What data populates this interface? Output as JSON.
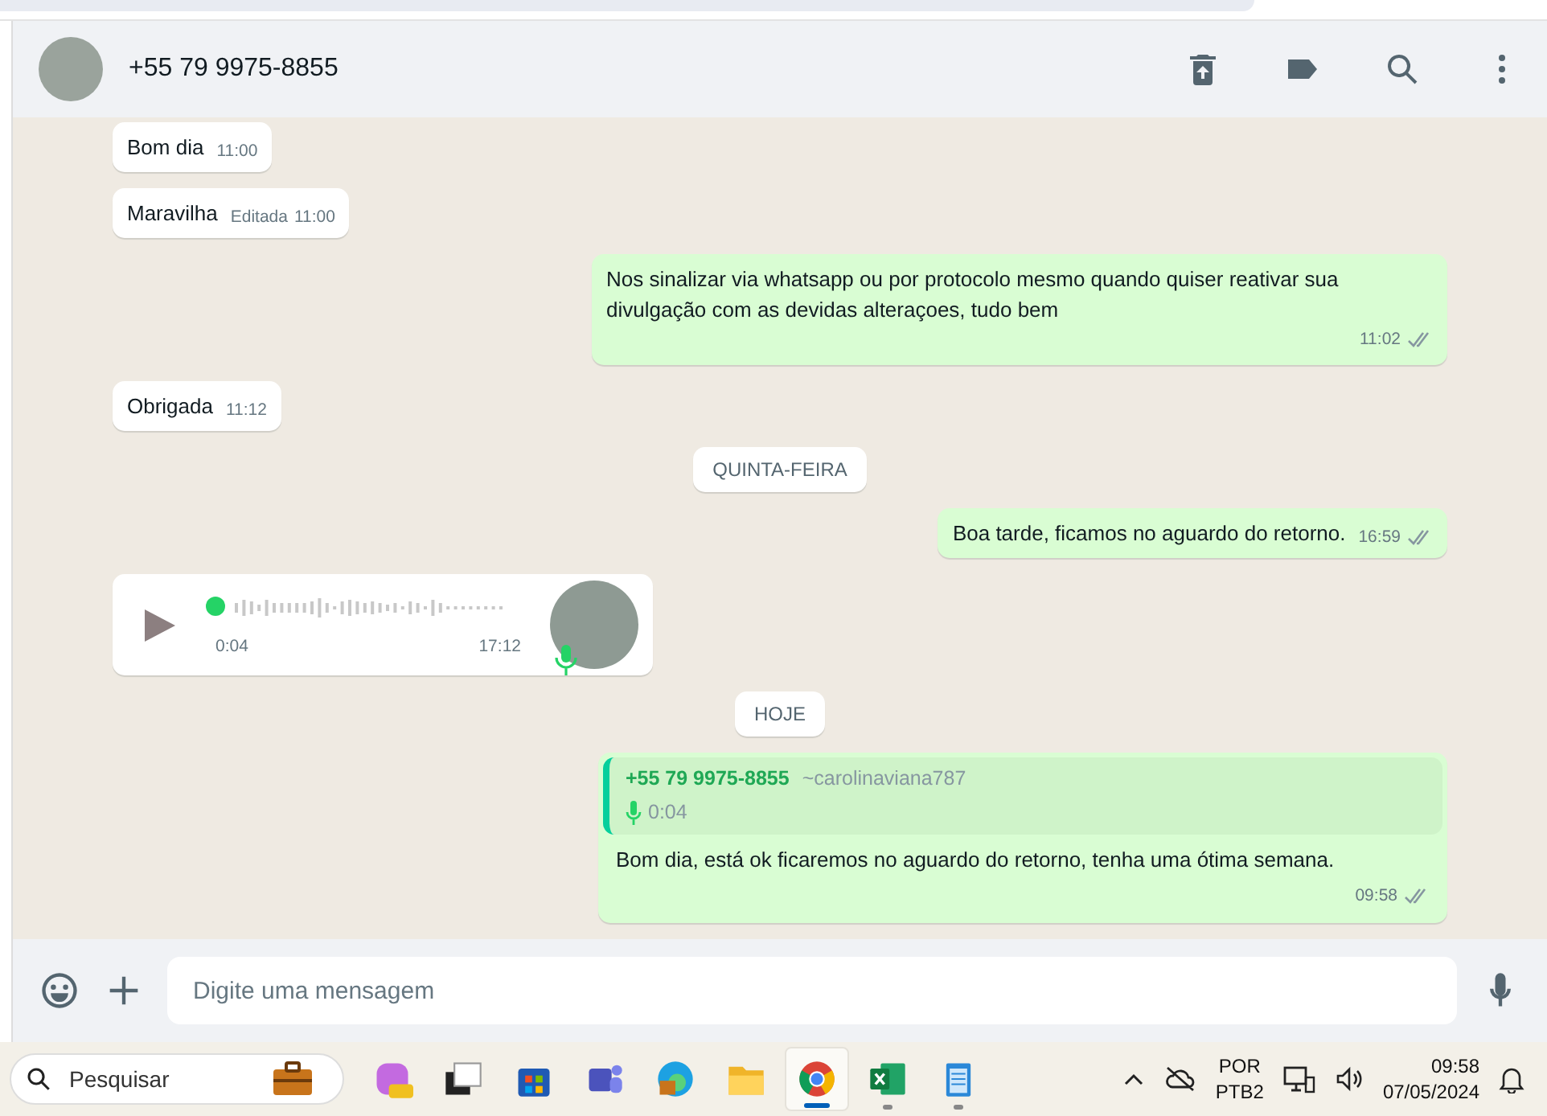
{
  "header": {
    "contact": "+55 79 9975-8855"
  },
  "messages": [
    {
      "kind": "text",
      "outgoing": false,
      "text": "Bom dia",
      "time": "11:00",
      "read": false
    },
    {
      "kind": "text",
      "outgoing": false,
      "text": "Maravilha",
      "edited": "Editada",
      "time": "11:00",
      "read": false
    },
    {
      "kind": "text",
      "outgoing": true,
      "text": "Nos sinalizar via whatsapp ou por protocolo mesmo quando quiser reativar sua divulgação com as devidas alteraçoes, tudo bem",
      "time": "11:02",
      "read": true
    },
    {
      "kind": "text",
      "outgoing": false,
      "text": "Obrigada",
      "time": "11:12",
      "read": false
    },
    {
      "kind": "date",
      "text": "QUINTA-FEIRA"
    },
    {
      "kind": "text",
      "outgoing": true,
      "text": "Boa tarde, ficamos no aguardo do retorno.",
      "time": "16:59",
      "read": true
    },
    {
      "kind": "audio",
      "outgoing": false,
      "duration": "0:04",
      "time": "17:12"
    },
    {
      "kind": "date",
      "text": "HOJE"
    },
    {
      "kind": "reply",
      "outgoing": true,
      "quote_author": "+55 79 9975-8855",
      "quote_handle": "~carolinaviana787",
      "quote_text": "0:04",
      "text": "Bom dia, está ok ficaremos no aguardo do retorno, tenha uma ótima semana.",
      "time": "09:58",
      "read": true
    }
  ],
  "composer": {
    "placeholder": "Digite uma mensagem"
  },
  "taskbar": {
    "search_placeholder": "Pesquisar",
    "apps": [
      {
        "kind": "copilot",
        "running": false,
        "selected": false
      },
      {
        "kind": "windows",
        "running": false,
        "selected": false
      },
      {
        "kind": "store",
        "running": false,
        "selected": false
      },
      {
        "kind": "teams",
        "running": false,
        "selected": false
      },
      {
        "kind": "edge",
        "running": false,
        "selected": false
      },
      {
        "kind": "folder",
        "running": false,
        "selected": false
      },
      {
        "kind": "chrome",
        "running": true,
        "selected": true
      },
      {
        "kind": "excel",
        "running": true,
        "selected": false
      },
      {
        "kind": "notepad",
        "running": true,
        "selected": false
      }
    ],
    "language": "POR",
    "layout": "PTB2",
    "time": "09:58",
    "date": "07/05/2024"
  }
}
